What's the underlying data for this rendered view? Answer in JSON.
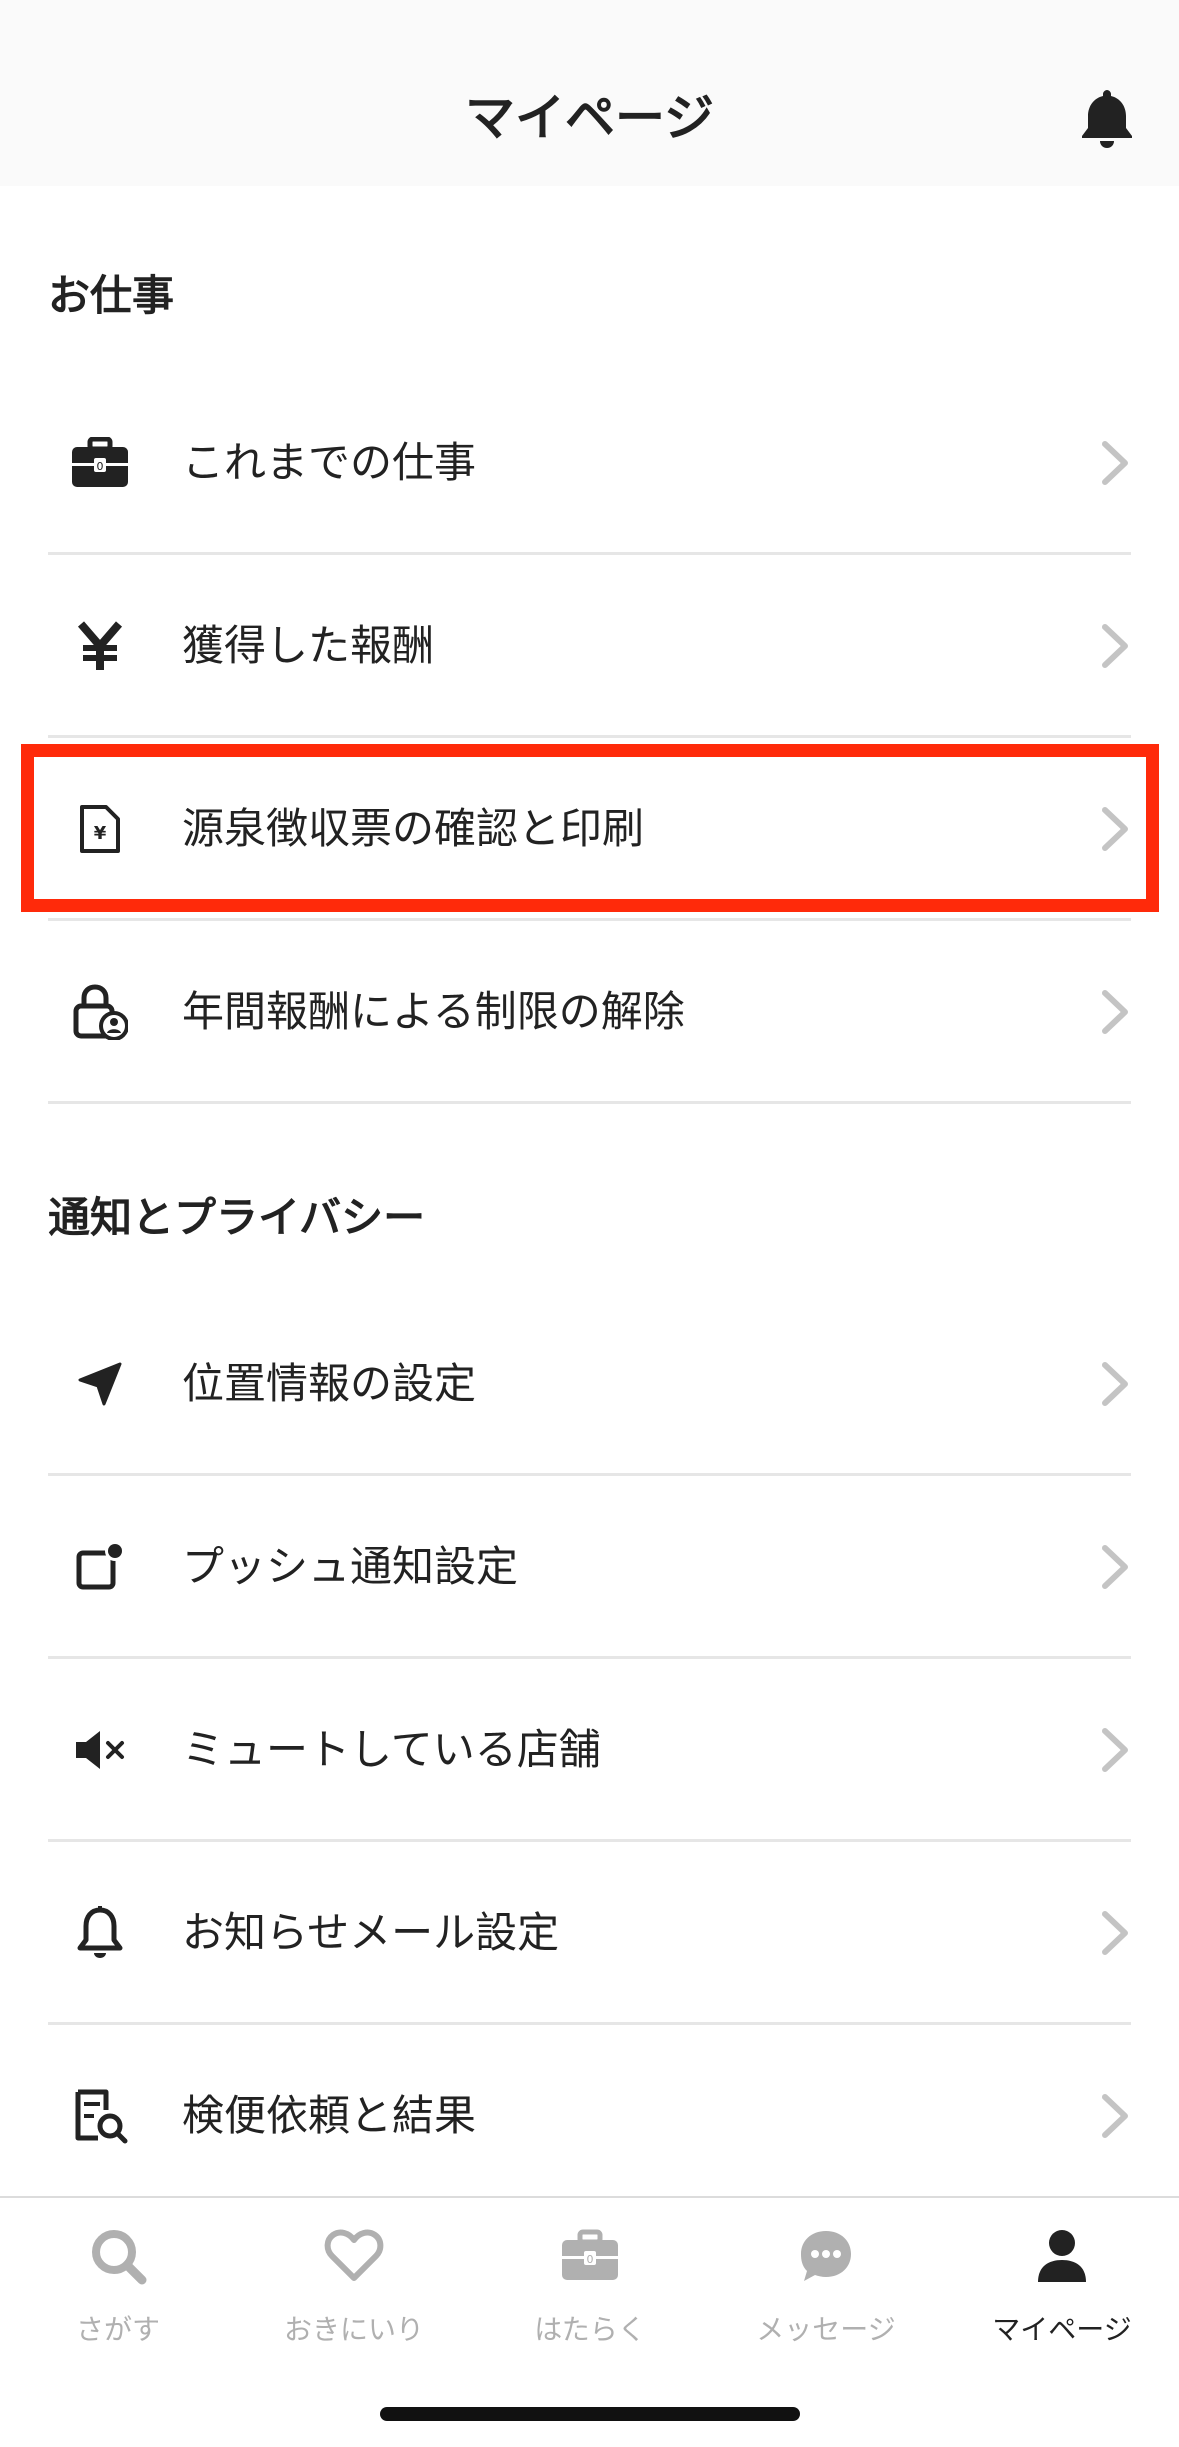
{
  "header": {
    "title": "マイページ",
    "bell_icon": "bell-icon"
  },
  "sections": [
    {
      "title": "お仕事",
      "items": [
        {
          "label": "これまでの仕事",
          "icon": "briefcase-icon"
        },
        {
          "label": "獲得した報酬",
          "icon": "yen-icon"
        },
        {
          "label": "源泉徴収票の確認と印刷",
          "icon": "yen-document-icon",
          "highlighted": true
        },
        {
          "label": "年間報酬による制限の解除",
          "icon": "lock-user-icon"
        }
      ]
    },
    {
      "title": "通知とプライバシー",
      "items": [
        {
          "label": "位置情報の設定",
          "icon": "location-arrow-icon"
        },
        {
          "label": "プッシュ通知設定",
          "icon": "push-notification-icon"
        },
        {
          "label": "ミュートしている店舗",
          "icon": "mute-icon"
        },
        {
          "label": "お知らせメール設定",
          "icon": "bell-outline-icon"
        },
        {
          "label": "検便依頼と結果",
          "icon": "test-search-icon"
        }
      ]
    }
  ],
  "highlight_color": "#ff2a0a",
  "tabbar": {
    "tabs": [
      {
        "label": "さがす",
        "icon": "search-icon",
        "active": false
      },
      {
        "label": "おきにいり",
        "icon": "heart-icon",
        "active": false
      },
      {
        "label": "はたらく",
        "icon": "briefcase-icon",
        "active": false
      },
      {
        "label": "メッセージ",
        "icon": "chat-bubble-icon",
        "active": false
      },
      {
        "label": "マイページ",
        "icon": "person-icon",
        "active": true
      }
    ]
  }
}
